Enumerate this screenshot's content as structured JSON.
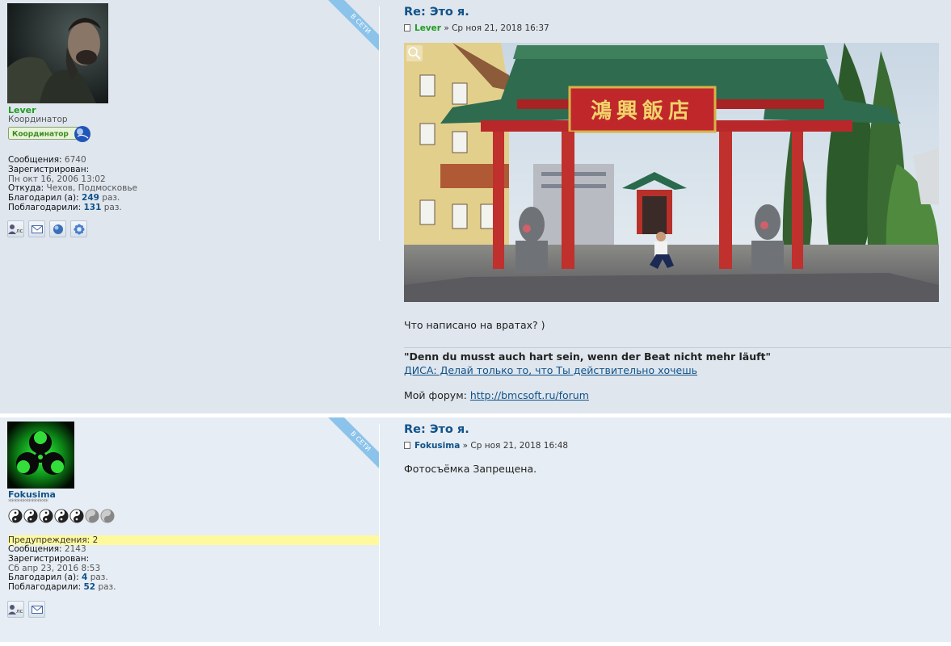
{
  "posts": [
    {
      "online_label": "В СЕТИ",
      "username": "Lever",
      "rank": "Координатор",
      "rank_badge": "Координатор",
      "info": {
        "messages_label": "Сообщения:",
        "messages": "6740",
        "registered_label": "Зарегистрирован:",
        "registered": "Пн окт 16, 2006 13:02",
        "from_label": "Откуда:",
        "from": "Чехов, Подмосковье",
        "thanked_label": "Благодарил (а):",
        "thanked": "249",
        "thanked_suffix": "раз.",
        "thanks_received_label": "Поблагодарили:",
        "thanks_received": "131",
        "thanks_received_suffix": "раз."
      },
      "contacts": [
        "pm-icon",
        "email-icon",
        "website-icon",
        "icq-icon"
      ],
      "contacts_pm_label": "лс",
      "title": "Re: Это я.",
      "meta_author": "Lever",
      "meta_sep": "»",
      "meta_date": "Ср ноя 21, 2018 16:37",
      "image_sign_text": "鴻興飯店",
      "body": "Что написано на вратах? )",
      "signature": {
        "quote": "\"Denn du musst auch hart sein, wenn der Beat nicht mehr läuft\"",
        "link1": "ДИСА: Делай только то, что Ты действительно хочешь",
        "forum_label": "Мой форум:",
        "forum_link": "http://bmcsoft.ru/forum"
      }
    },
    {
      "online_label": "В СЕТИ",
      "username": "Fokusima",
      "stars": "**************",
      "warnings_label": "Предупреждения:",
      "warnings": "2",
      "info": {
        "messages_label": "Сообщения:",
        "messages": "2143",
        "registered_label": "Зарегистрирован:",
        "registered": "Сб апр 23, 2016 8:53",
        "thanked_label": "Благодарил (а):",
        "thanked": "4",
        "thanked_suffix": "раз.",
        "thanks_received_label": "Поблагодарили:",
        "thanks_received": "52",
        "thanks_received_suffix": "раз."
      },
      "contacts": [
        "pm-icon",
        "email-icon"
      ],
      "contacts_pm_label": "лс",
      "title": "Re: Это я.",
      "meta_author": "Fokusima",
      "meta_sep": "»",
      "meta_date": "Ср ноя 21, 2018 16:48",
      "body": "Фотосъёмка Запрещена."
    }
  ],
  "colors": {
    "post_bg_1": "#dfe6ee",
    "post_bg_2": "#e6edf4",
    "link": "#105289",
    "coordinator_green": "#1e9e1e",
    "warning_highlight": "#fff99e",
    "online_ribbon": "#8cc3ea"
  }
}
